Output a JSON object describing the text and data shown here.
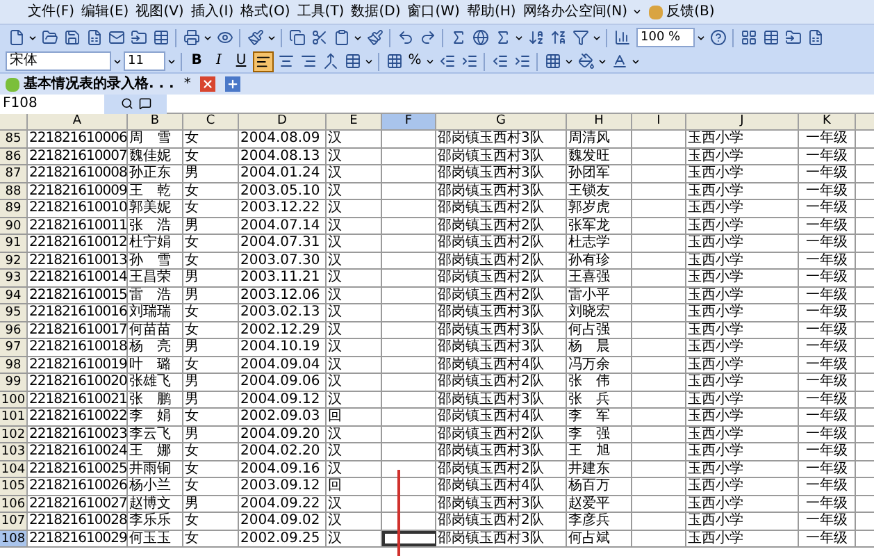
{
  "menu": [
    {
      "label": "文件(F)"
    },
    {
      "label": "编辑(E)"
    },
    {
      "label": "视图(V)"
    },
    {
      "label": "插入(I)"
    },
    {
      "label": "格式(O)"
    },
    {
      "label": "工具(T)"
    },
    {
      "label": "数据(D)"
    },
    {
      "label": "窗口(W)"
    },
    {
      "label": "帮助(H)"
    },
    {
      "label": "网络办公空间(N)"
    },
    {
      "label": "反馈(B)"
    }
  ],
  "standard_toolbar": {
    "zoom": "100 %"
  },
  "format_toolbar": {
    "font": "宋体",
    "size": "11",
    "bold": "B",
    "italic": "I",
    "underline": "U",
    "percent": "%"
  },
  "document_tab": {
    "title": "基本情况表的录入格. . .",
    "modified": "*"
  },
  "formula_bar": {
    "name_box": "F108"
  },
  "columns": [
    {
      "label": "A",
      "selected": false
    },
    {
      "label": "B",
      "selected": false
    },
    {
      "label": "C",
      "selected": false
    },
    {
      "label": "D",
      "selected": false
    },
    {
      "label": "E",
      "selected": false
    },
    {
      "label": "F",
      "selected": true
    },
    {
      "label": "G",
      "selected": false
    },
    {
      "label": "H",
      "selected": false
    },
    {
      "label": "I",
      "selected": false
    },
    {
      "label": "J",
      "selected": false
    },
    {
      "label": "K",
      "selected": false
    }
  ],
  "rows": [
    {
      "number": "85",
      "id": "221821610006",
      "name": "周　雪",
      "gender": "女",
      "birth": "2004.08.09",
      "ethnicity": "汉",
      "address": "邵岗镇玉西村3队",
      "guardian": "周清风",
      "school": "玉西小学",
      "grade": "一年级",
      "selected": false
    },
    {
      "number": "86",
      "id": "221821610007",
      "name": "魏佳妮",
      "gender": "女",
      "birth": "2004.08.13",
      "ethnicity": "汉",
      "address": "邵岗镇玉西村3队",
      "guardian": "魏发旺",
      "school": "玉西小学",
      "grade": "一年级",
      "selected": false
    },
    {
      "number": "87",
      "id": "221821610008",
      "name": "孙正东",
      "gender": "男",
      "birth": "2004.01.24",
      "ethnicity": "汉",
      "address": "邵岗镇玉西村3队",
      "guardian": "孙团军",
      "school": "玉西小学",
      "grade": "一年级",
      "selected": false
    },
    {
      "number": "88",
      "id": "221821610009",
      "name": "王　乾",
      "gender": "女",
      "birth": "2003.05.10",
      "ethnicity": "汉",
      "address": "邵岗镇玉西村3队",
      "guardian": "王锁友",
      "school": "玉西小学",
      "grade": "一年级",
      "selected": false
    },
    {
      "number": "89",
      "id": "221821610010",
      "name": "郭美妮",
      "gender": "女",
      "birth": "2003.12.22",
      "ethnicity": "汉",
      "address": "邵岗镇玉西村2队",
      "guardian": "郭岁虎",
      "school": "玉西小学",
      "grade": "一年级",
      "selected": false
    },
    {
      "number": "90",
      "id": "221821610011",
      "name": "张　浩",
      "gender": "男",
      "birth": "2004.07.14",
      "ethnicity": "汉",
      "address": "邵岗镇玉西村2队",
      "guardian": "张军龙",
      "school": "玉西小学",
      "grade": "一年级",
      "selected": false
    },
    {
      "number": "91",
      "id": "221821610012",
      "name": "杜宁娟",
      "gender": "女",
      "birth": "2004.07.31",
      "ethnicity": "汉",
      "address": "邵岗镇玉西村2队",
      "guardian": "杜志学",
      "school": "玉西小学",
      "grade": "一年级",
      "selected": false
    },
    {
      "number": "92",
      "id": "221821610013",
      "name": "孙　雪",
      "gender": "女",
      "birth": "2003.07.30",
      "ethnicity": "汉",
      "address": "邵岗镇玉西村2队",
      "guardian": "孙有珍",
      "school": "玉西小学",
      "grade": "一年级",
      "selected": false
    },
    {
      "number": "93",
      "id": "221821610014",
      "name": "王昌荣",
      "gender": "男",
      "birth": "2003.11.21",
      "ethnicity": "汉",
      "address": "邵岗镇玉西村2队",
      "guardian": "王喜强",
      "school": "玉西小学",
      "grade": "一年级",
      "selected": false
    },
    {
      "number": "94",
      "id": "221821610015",
      "name": "雷　浩",
      "gender": "男",
      "birth": "2003.12.06",
      "ethnicity": "汉",
      "address": "邵岗镇玉西村2队",
      "guardian": "雷小平",
      "school": "玉西小学",
      "grade": "一年级",
      "selected": false
    },
    {
      "number": "95",
      "id": "221821610016",
      "name": "刘瑞瑞",
      "gender": "女",
      "birth": "2003.02.13",
      "ethnicity": "汉",
      "address": "邵岗镇玉西村3队",
      "guardian": "刘晓宏",
      "school": "玉西小学",
      "grade": "一年级",
      "selected": false
    },
    {
      "number": "96",
      "id": "221821610017",
      "name": "何苗苗",
      "gender": "女",
      "birth": "2002.12.29",
      "ethnicity": "汉",
      "address": "邵岗镇玉西村3队",
      "guardian": "何占强",
      "school": "玉西小学",
      "grade": "一年级",
      "selected": false
    },
    {
      "number": "97",
      "id": "221821610018",
      "name": "杨　亮",
      "gender": "男",
      "birth": "2004.10.19",
      "ethnicity": "汉",
      "address": "邵岗镇玉西村3队",
      "guardian": "杨　晨",
      "school": "玉西小学",
      "grade": "一年级",
      "selected": false
    },
    {
      "number": "98",
      "id": "221821610019",
      "name": "叶　璐",
      "gender": "女",
      "birth": "2004.09.04",
      "ethnicity": "汉",
      "address": "邵岗镇玉西村4队",
      "guardian": "冯万余",
      "school": "玉西小学",
      "grade": "一年级",
      "selected": false
    },
    {
      "number": "99",
      "id": "221821610020",
      "name": "张雄飞",
      "gender": "男",
      "birth": "2004.09.06",
      "ethnicity": "汉",
      "address": "邵岗镇玉西村2队",
      "guardian": "张　伟",
      "school": "玉西小学",
      "grade": "一年级",
      "selected": false
    },
    {
      "number": "100",
      "id": "221821610021",
      "name": "张　鹏",
      "gender": "男",
      "birth": "2004.09.12",
      "ethnicity": "汉",
      "address": "邵岗镇玉西村3队",
      "guardian": "张　兵",
      "school": "玉西小学",
      "grade": "一年级",
      "selected": false
    },
    {
      "number": "101",
      "id": "221821610022",
      "name": "李　娟",
      "gender": "女",
      "birth": "2002.09.03",
      "ethnicity": "回",
      "address": "邵岗镇玉西村4队",
      "guardian": "李　军",
      "school": "玉西小学",
      "grade": "一年级",
      "selected": false
    },
    {
      "number": "102",
      "id": "221821610023",
      "name": "李云飞",
      "gender": "男",
      "birth": "2004.09.20",
      "ethnicity": "汉",
      "address": "邵岗镇玉西村2队",
      "guardian": "李　强",
      "school": "玉西小学",
      "grade": "一年级",
      "selected": false
    },
    {
      "number": "103",
      "id": "221821610024",
      "name": "王　娜",
      "gender": "女",
      "birth": "2004.02.20",
      "ethnicity": "汉",
      "address": "邵岗镇玉西村3队",
      "guardian": "王　旭",
      "school": "玉西小学",
      "grade": "一年级",
      "selected": false
    },
    {
      "number": "104",
      "id": "221821610025",
      "name": "井雨铜",
      "gender": "女",
      "birth": "2004.09.16",
      "ethnicity": "汉",
      "address": "邵岗镇玉西村2队",
      "guardian": "井建东",
      "school": "玉西小学",
      "grade": "一年级",
      "selected": false
    },
    {
      "number": "105",
      "id": "221821610026",
      "name": "杨小兰",
      "gender": "女",
      "birth": "2003.09.12",
      "ethnicity": "回",
      "address": "邵岗镇玉西村4队",
      "guardian": "杨百万",
      "school": "玉西小学",
      "grade": "一年级",
      "selected": false
    },
    {
      "number": "106",
      "id": "221821610027",
      "name": "赵博文",
      "gender": "男",
      "birth": "2004.09.22",
      "ethnicity": "汉",
      "address": "邵岗镇玉西村3队",
      "guardian": "赵爱平",
      "school": "玉西小学",
      "grade": "一年级",
      "selected": false
    },
    {
      "number": "107",
      "id": "221821610028",
      "name": "李乐乐",
      "gender": "女",
      "birth": "2004.09.02",
      "ethnicity": "汉",
      "address": "邵岗镇玉西村2队",
      "guardian": "李彦兵",
      "school": "玉西小学",
      "grade": "一年级",
      "selected": false
    },
    {
      "number": "108",
      "id": "221821610029",
      "name": "何玉玉",
      "gender": "女",
      "birth": "2002.09.25",
      "ethnicity": "汉",
      "address": "邵岗镇玉西村3队",
      "guardian": "何占斌",
      "school": "玉西小学",
      "grade": "一年级",
      "selected": true
    }
  ]
}
